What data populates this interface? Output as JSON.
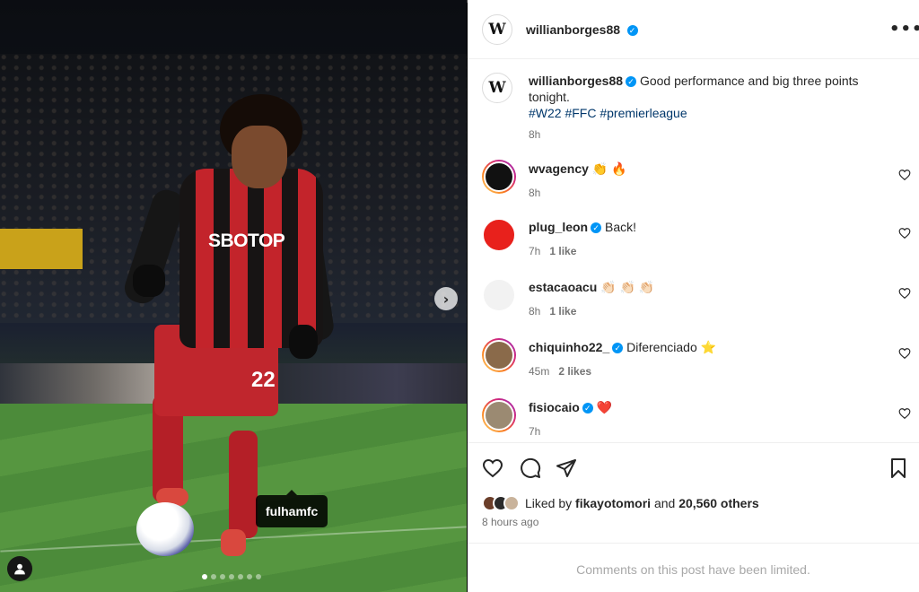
{
  "post": {
    "author": "willianborges88",
    "author_avatar_letter": "W",
    "caption_text": "Good performance and big three points tonight.",
    "hashtags": "#W22 #FFC #premierleague",
    "caption_time": "8h"
  },
  "media": {
    "sponsor": "SBOTOP",
    "shirt_number": "22",
    "tag_tooltip": "fulhamfc",
    "carousel_count": 7,
    "carousel_active": 0
  },
  "comments": [
    {
      "user": "wvagency",
      "verified": false,
      "text": "👏 🔥",
      "time": "8h",
      "likes": "",
      "avatar_color": "#111111",
      "ring": true
    },
    {
      "user": "plug_leon",
      "verified": true,
      "text": "Back!",
      "time": "7h",
      "likes": "1 like",
      "avatar_color": "#e8211c",
      "ring": false
    },
    {
      "user": "estacaoacu",
      "verified": false,
      "text": "👏🏻 👏🏻 👏🏻",
      "time": "8h",
      "likes": "1 like",
      "avatar_color": "#f2f2f2",
      "ring": false
    },
    {
      "user": "chiquinho22_",
      "verified": true,
      "text": "Diferenciado ⭐",
      "time": "45m",
      "likes": "2 likes",
      "avatar_color": "#8a6a4a",
      "ring": true
    },
    {
      "user": "fisiocaio",
      "verified": true,
      "text": "❤️",
      "time": "7h",
      "likes": "",
      "avatar_color": "#9b8a72",
      "ring": true
    }
  ],
  "engagement": {
    "liked_by_prefix": "Liked by",
    "liked_by_user": "fikayotomori",
    "liked_by_and": "and",
    "liked_by_count": "20,560 others",
    "posted_ago": "8 hours ago"
  },
  "footer": {
    "limited_text": "Comments on this post have been limited."
  },
  "icons": {
    "more": "more-horizontal-icon",
    "like": "heart-icon",
    "comment": "comment-icon",
    "share": "send-icon",
    "save": "bookmark-icon",
    "next": "chevron-right-icon",
    "user_tags": "user-icon"
  },
  "colors": {
    "verified": "#0095f6",
    "hashtag": "#00376b",
    "muted": "#737373",
    "limited": "#a8a8a8"
  }
}
